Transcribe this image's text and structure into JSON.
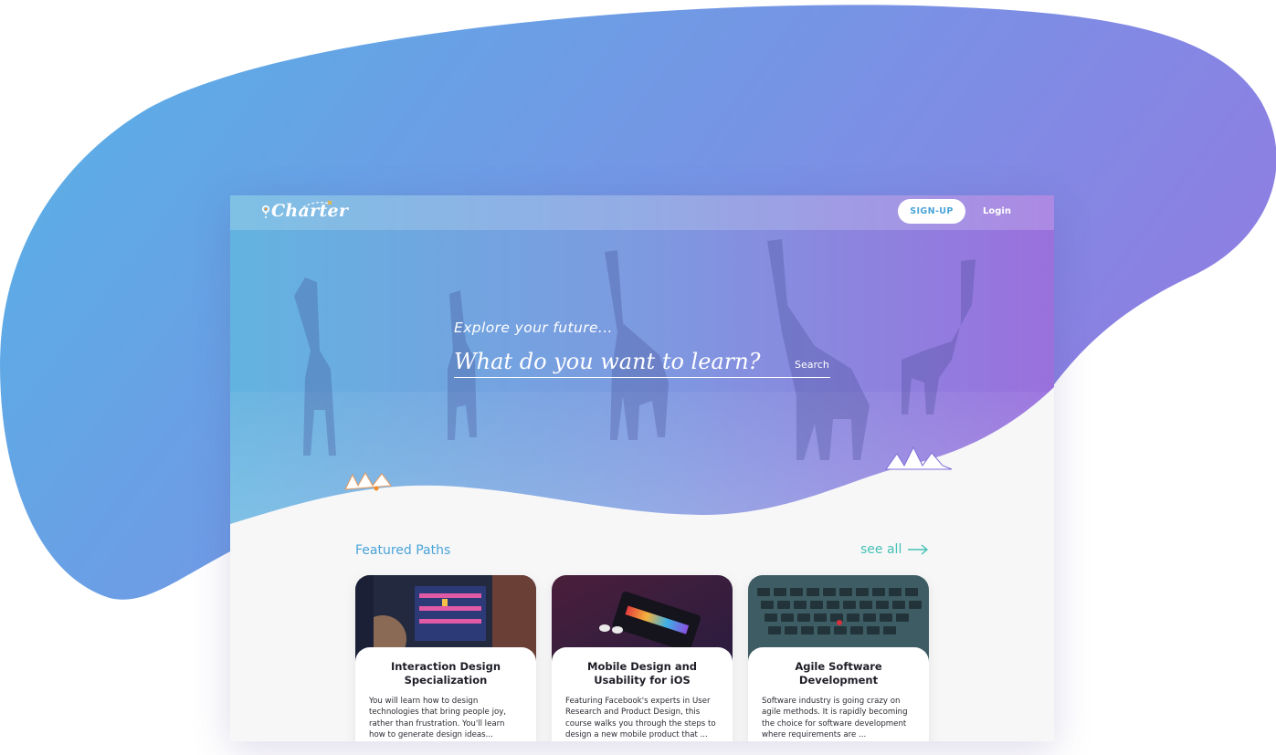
{
  "app": {
    "logo_text": "Charter",
    "logo_icon": "map-pin-icon"
  },
  "nav": {
    "signup_label": "SIGN-UP",
    "login_label": "Login"
  },
  "hero": {
    "tagline": "Explore your future...",
    "search_placeholder": "What do you want to learn?",
    "search_button_label": "Search"
  },
  "featured": {
    "title": "Featured Paths",
    "see_all_label": "see all",
    "see_all_icon": "arrow-right-icon",
    "cards": [
      {
        "title": "Interaction Design Specialization",
        "description": "You will learn how to design technologies that bring people joy, rather than frustration. You'll learn how to generate design ideas..."
      },
      {
        "title": "Mobile Design and Usability for iOS",
        "description": "Featuring Facebook's experts in User Research and Product Design, this course walks you through the steps to design a new mobile product that ..."
      },
      {
        "title": "Agile Software Development",
        "description": "Software industry is going crazy on agile methods.  It is rapidly becoming the choice for software development where requirements are ..."
      }
    ]
  },
  "colors": {
    "gradient_start": "#5cb0e6",
    "gradient_end": "#8b80e4",
    "accent_blue": "#4aa3d9",
    "accent_teal": "#46c2b4",
    "hero_purple": "#9a70dd"
  }
}
